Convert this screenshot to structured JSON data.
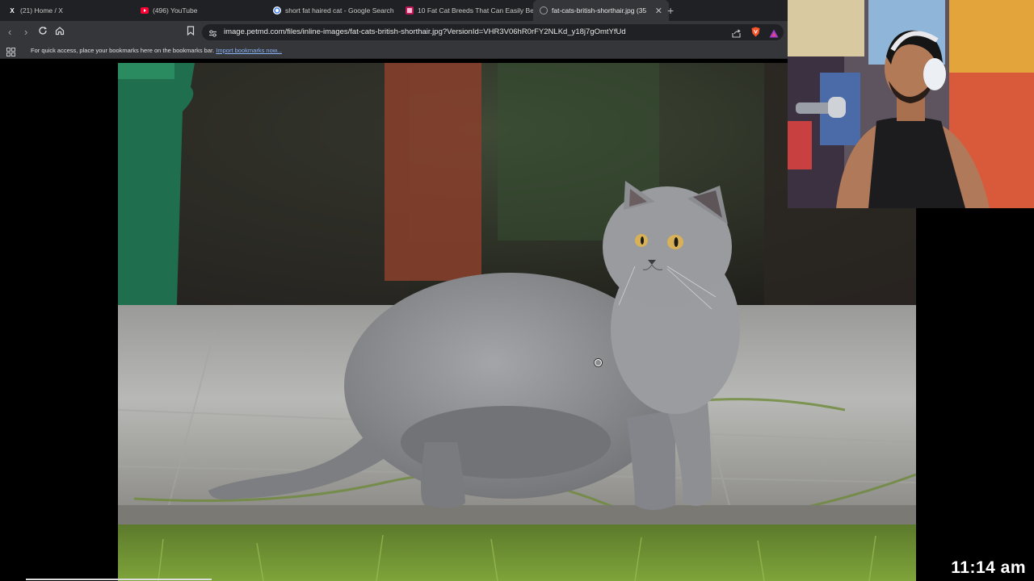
{
  "browser": {
    "tabs": [
      {
        "title": "(21) Home / X",
        "icon": "x-logo-icon",
        "active": false
      },
      {
        "title": "(496) YouTube",
        "icon": "youtube-icon",
        "active": false
      },
      {
        "title": "short fat haired cat - Google Search",
        "icon": "google-icon",
        "active": false
      },
      {
        "title": "10 Fat Cat Breeds That Can Easily Be",
        "icon": "petmd-icon",
        "active": false
      },
      {
        "title": "fat-cats-british-shorthair.jpg (35",
        "icon": "image-icon",
        "active": true
      }
    ],
    "new_tab": "+",
    "url": "image.petmd.com/files/inline-images/fat-cats-british-shorthair.jpg?VersionId=VHR3V06hR0rFY2NLKd_y18j7gOmtYfUd",
    "bookmarks_bar": {
      "text": "For quick access, place your bookmarks here on the bookmarks bar.",
      "link": "Import bookmarks now..."
    }
  },
  "colors": {
    "chrome_dark": "#202124",
    "chrome_mid": "#35363a",
    "link": "#8ab4f8",
    "cat_fur": "#8e8e90"
  },
  "overlay": {
    "clock": "11:14 am"
  }
}
